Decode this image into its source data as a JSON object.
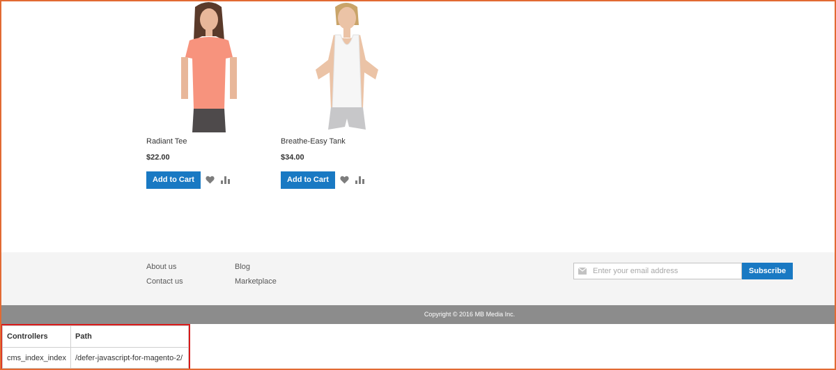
{
  "products": [
    {
      "name": "Radiant Tee",
      "price": "$22.00",
      "add_to_cart_label": "Add to Cart",
      "shirt_color": "#f7937d",
      "pants_color": "#4e4a4b"
    },
    {
      "name": "Breathe-Easy Tank",
      "price": "$34.00",
      "add_to_cart_label": "Add to Cart",
      "shirt_color": "#f6f6f6",
      "pants_color": "#c7c7c9"
    }
  ],
  "footer": {
    "links_col1": [
      "About us",
      "Contact us"
    ],
    "links_col2": [
      "Blog",
      "Marketplace"
    ],
    "newsletter_placeholder": "Enter your email address",
    "subscribe_label": "Subscribe"
  },
  "copyright": "Copyright © 2016 MB Media Inc.",
  "debug_table": {
    "headers": [
      "Controllers",
      "Path"
    ],
    "row": [
      "cms_index_index",
      "/defer-javascript-for-magento-2/"
    ]
  },
  "colors": {
    "accent": "#1979c3",
    "frame": "#e26a33",
    "highlight": "#d91a1a"
  }
}
